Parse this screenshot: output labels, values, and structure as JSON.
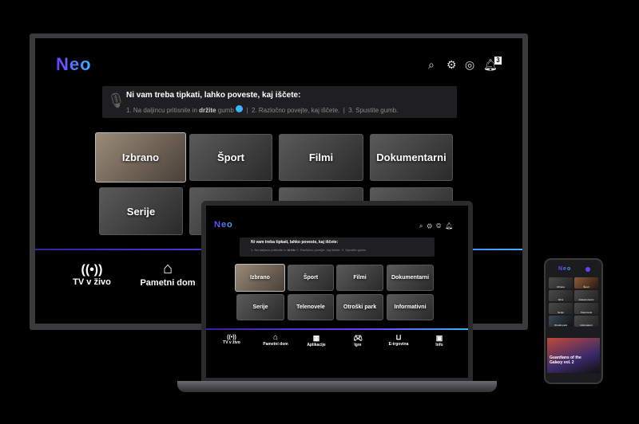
{
  "brand": {
    "logo": "Neo",
    "accent_start": "#6a3cff",
    "accent_end": "#3bb3ff"
  },
  "header": {
    "icons": [
      "search-icon",
      "gear-icon",
      "profile-icon",
      "bell-icon"
    ],
    "notification_count": "3"
  },
  "voice_hint": {
    "title": "Ni vam treba tipkati, lahko poveste, kaj iščete:",
    "step1_pre": "1. Na daljincu pritisnite in",
    "step1_bold": "držite",
    "step1_post": "gumb",
    "step2": "2. Razločno povejte, kaj iščete.",
    "step3": "3. Spustite gumb."
  },
  "categories": [
    "Izbrano",
    "Šport",
    "Filmi",
    "Dokumentarni",
    "Serije",
    "Telenovele",
    "Otroški park",
    "Informativni"
  ],
  "nav": [
    "TV v živo",
    "Pametni dom",
    "Aplikacije",
    "Igre",
    "E-trgovina",
    "Info"
  ],
  "phone": {
    "featured_title": "Guardians of the Galaxy vol. 2"
  }
}
